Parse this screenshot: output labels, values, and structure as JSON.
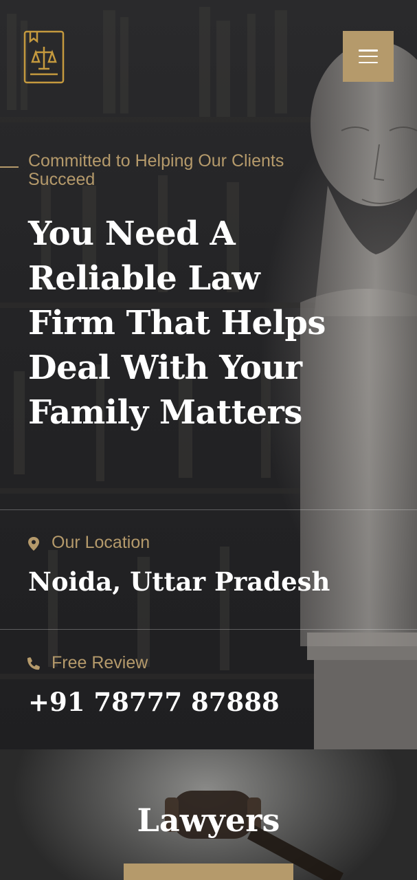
{
  "header": {
    "logo_icon": "law-book-scales-icon",
    "menu_icon": "hamburger-menu-icon"
  },
  "hero": {
    "tagline": "Committed to Helping Our Clients Succeed",
    "headline": "You Need A Reliable Law Firm That Helps Deal With Your Family Matters"
  },
  "info": {
    "location_label": "Our Location",
    "location_value": "Noida, Uttar Pradesh",
    "review_label": "Free Review",
    "review_value": "+91 78777 87888"
  },
  "lawyers": {
    "title": "Lawyers"
  },
  "colors": {
    "accent": "#b59a6b",
    "background": "#1e1e20",
    "text": "#ffffff"
  }
}
